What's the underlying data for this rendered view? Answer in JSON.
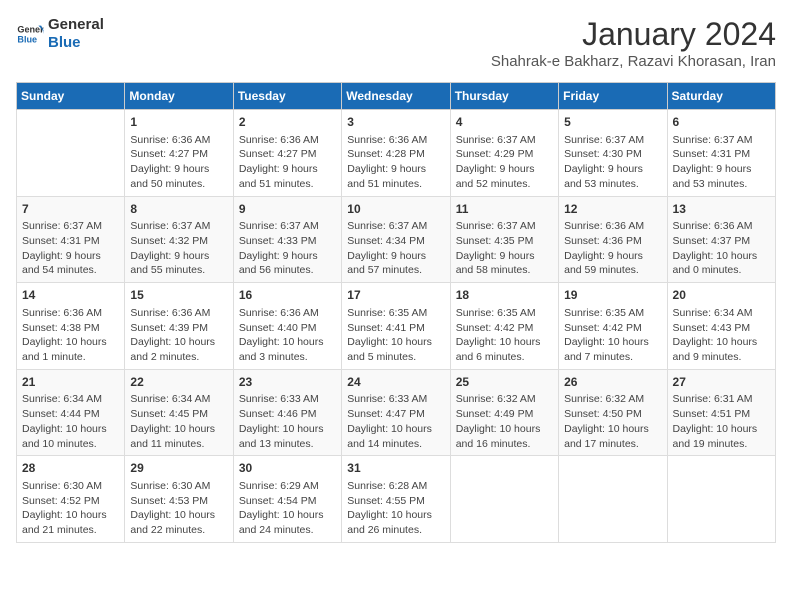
{
  "logo": {
    "line1": "General",
    "line2": "Blue"
  },
  "title": "January 2024",
  "location": "Shahrak-e Bakharz, Razavi Khorasan, Iran",
  "days_header": [
    "Sunday",
    "Monday",
    "Tuesday",
    "Wednesday",
    "Thursday",
    "Friday",
    "Saturday"
  ],
  "weeks": [
    [
      {
        "num": "",
        "detail": ""
      },
      {
        "num": "1",
        "detail": "Sunrise: 6:36 AM\nSunset: 4:27 PM\nDaylight: 9 hours\nand 50 minutes."
      },
      {
        "num": "2",
        "detail": "Sunrise: 6:36 AM\nSunset: 4:27 PM\nDaylight: 9 hours\nand 51 minutes."
      },
      {
        "num": "3",
        "detail": "Sunrise: 6:36 AM\nSunset: 4:28 PM\nDaylight: 9 hours\nand 51 minutes."
      },
      {
        "num": "4",
        "detail": "Sunrise: 6:37 AM\nSunset: 4:29 PM\nDaylight: 9 hours\nand 52 minutes."
      },
      {
        "num": "5",
        "detail": "Sunrise: 6:37 AM\nSunset: 4:30 PM\nDaylight: 9 hours\nand 53 minutes."
      },
      {
        "num": "6",
        "detail": "Sunrise: 6:37 AM\nSunset: 4:31 PM\nDaylight: 9 hours\nand 53 minutes."
      }
    ],
    [
      {
        "num": "7",
        "detail": "Sunrise: 6:37 AM\nSunset: 4:31 PM\nDaylight: 9 hours\nand 54 minutes."
      },
      {
        "num": "8",
        "detail": "Sunrise: 6:37 AM\nSunset: 4:32 PM\nDaylight: 9 hours\nand 55 minutes."
      },
      {
        "num": "9",
        "detail": "Sunrise: 6:37 AM\nSunset: 4:33 PM\nDaylight: 9 hours\nand 56 minutes."
      },
      {
        "num": "10",
        "detail": "Sunrise: 6:37 AM\nSunset: 4:34 PM\nDaylight: 9 hours\nand 57 minutes."
      },
      {
        "num": "11",
        "detail": "Sunrise: 6:37 AM\nSunset: 4:35 PM\nDaylight: 9 hours\nand 58 minutes."
      },
      {
        "num": "12",
        "detail": "Sunrise: 6:36 AM\nSunset: 4:36 PM\nDaylight: 9 hours\nand 59 minutes."
      },
      {
        "num": "13",
        "detail": "Sunrise: 6:36 AM\nSunset: 4:37 PM\nDaylight: 10 hours\nand 0 minutes."
      }
    ],
    [
      {
        "num": "14",
        "detail": "Sunrise: 6:36 AM\nSunset: 4:38 PM\nDaylight: 10 hours\nand 1 minute."
      },
      {
        "num": "15",
        "detail": "Sunrise: 6:36 AM\nSunset: 4:39 PM\nDaylight: 10 hours\nand 2 minutes."
      },
      {
        "num": "16",
        "detail": "Sunrise: 6:36 AM\nSunset: 4:40 PM\nDaylight: 10 hours\nand 3 minutes."
      },
      {
        "num": "17",
        "detail": "Sunrise: 6:35 AM\nSunset: 4:41 PM\nDaylight: 10 hours\nand 5 minutes."
      },
      {
        "num": "18",
        "detail": "Sunrise: 6:35 AM\nSunset: 4:42 PM\nDaylight: 10 hours\nand 6 minutes."
      },
      {
        "num": "19",
        "detail": "Sunrise: 6:35 AM\nSunset: 4:42 PM\nDaylight: 10 hours\nand 7 minutes."
      },
      {
        "num": "20",
        "detail": "Sunrise: 6:34 AM\nSunset: 4:43 PM\nDaylight: 10 hours\nand 9 minutes."
      }
    ],
    [
      {
        "num": "21",
        "detail": "Sunrise: 6:34 AM\nSunset: 4:44 PM\nDaylight: 10 hours\nand 10 minutes."
      },
      {
        "num": "22",
        "detail": "Sunrise: 6:34 AM\nSunset: 4:45 PM\nDaylight: 10 hours\nand 11 minutes."
      },
      {
        "num": "23",
        "detail": "Sunrise: 6:33 AM\nSunset: 4:46 PM\nDaylight: 10 hours\nand 13 minutes."
      },
      {
        "num": "24",
        "detail": "Sunrise: 6:33 AM\nSunset: 4:47 PM\nDaylight: 10 hours\nand 14 minutes."
      },
      {
        "num": "25",
        "detail": "Sunrise: 6:32 AM\nSunset: 4:49 PM\nDaylight: 10 hours\nand 16 minutes."
      },
      {
        "num": "26",
        "detail": "Sunrise: 6:32 AM\nSunset: 4:50 PM\nDaylight: 10 hours\nand 17 minutes."
      },
      {
        "num": "27",
        "detail": "Sunrise: 6:31 AM\nSunset: 4:51 PM\nDaylight: 10 hours\nand 19 minutes."
      }
    ],
    [
      {
        "num": "28",
        "detail": "Sunrise: 6:30 AM\nSunset: 4:52 PM\nDaylight: 10 hours\nand 21 minutes."
      },
      {
        "num": "29",
        "detail": "Sunrise: 6:30 AM\nSunset: 4:53 PM\nDaylight: 10 hours\nand 22 minutes."
      },
      {
        "num": "30",
        "detail": "Sunrise: 6:29 AM\nSunset: 4:54 PM\nDaylight: 10 hours\nand 24 minutes."
      },
      {
        "num": "31",
        "detail": "Sunrise: 6:28 AM\nSunset: 4:55 PM\nDaylight: 10 hours\nand 26 minutes."
      },
      {
        "num": "",
        "detail": ""
      },
      {
        "num": "",
        "detail": ""
      },
      {
        "num": "",
        "detail": ""
      }
    ]
  ]
}
